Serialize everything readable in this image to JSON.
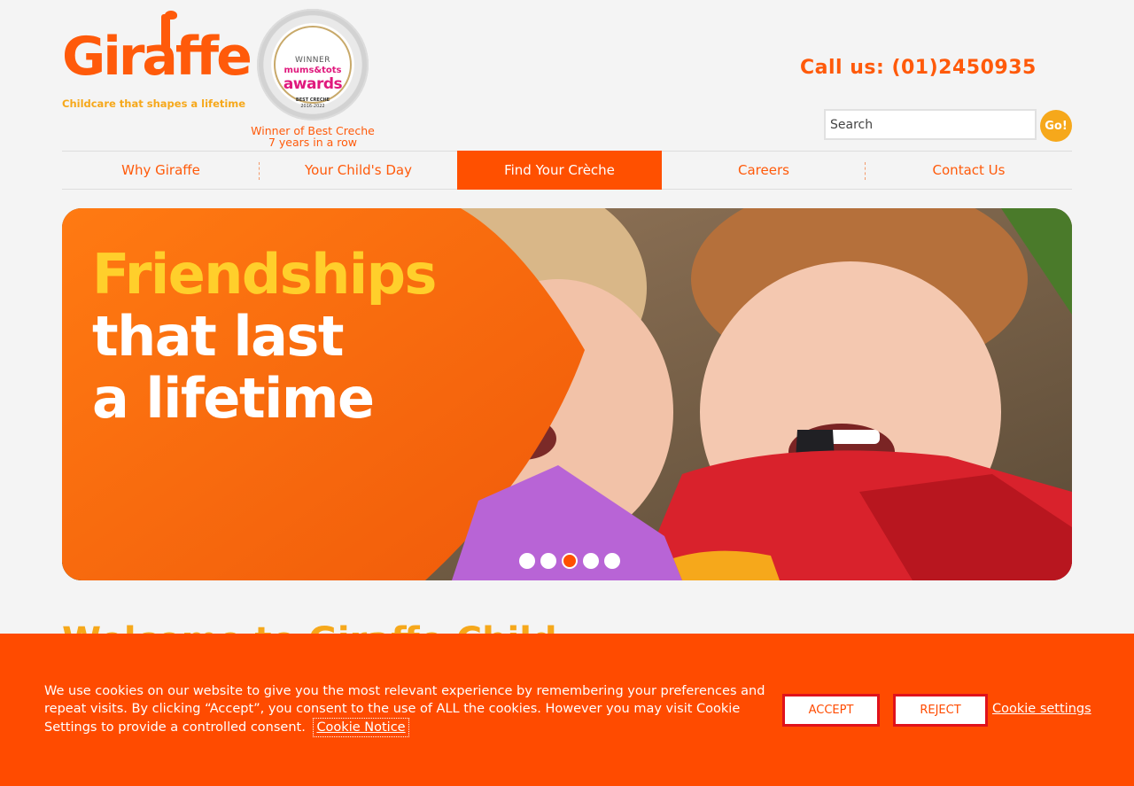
{
  "brand": {
    "logo_text": "Giraffe",
    "tagline": "Childcare that shapes a lifetime",
    "accent": "#ff5000",
    "secondary": "#f6a81b"
  },
  "award": {
    "seal_winner": "WINNER",
    "seal_brand_top": "mums&tots",
    "seal_brand_bottom": "awards",
    "seal_category": "BEST CRECHE",
    "seal_years": "2016-2022",
    "caption_line1": "Winner of Best Creche",
    "caption_line2": "7 years in a row"
  },
  "header": {
    "call_us": "Call us: (01)2450935",
    "search_placeholder": "Search",
    "search_button": "Go!"
  },
  "nav": {
    "items": [
      {
        "label": "Why Giraffe"
      },
      {
        "label": "Your Child's Day"
      },
      {
        "label": "Find Your Crèche"
      },
      {
        "label": "Careers"
      },
      {
        "label": "Contact Us"
      }
    ],
    "active_index": 2
  },
  "hero": {
    "line1": "Friendships",
    "line2": "that last",
    "line3": "a lifetime",
    "slide_count": 5,
    "active_slide": 3
  },
  "main": {
    "welcome_heading": "Welcome to Giraffe Child"
  },
  "cookie": {
    "message": "We use cookies on our website to give you the most relevant experience by remembering your preferences and repeat visits. By clicking “Accept”, you consent to the use of ALL the cookies. However you may visit Cookie Settings to provide a controlled consent.",
    "notice_link": "Cookie Notice",
    "accept": "ACCEPT",
    "reject": "REJECT",
    "settings": "Cookie settings"
  }
}
